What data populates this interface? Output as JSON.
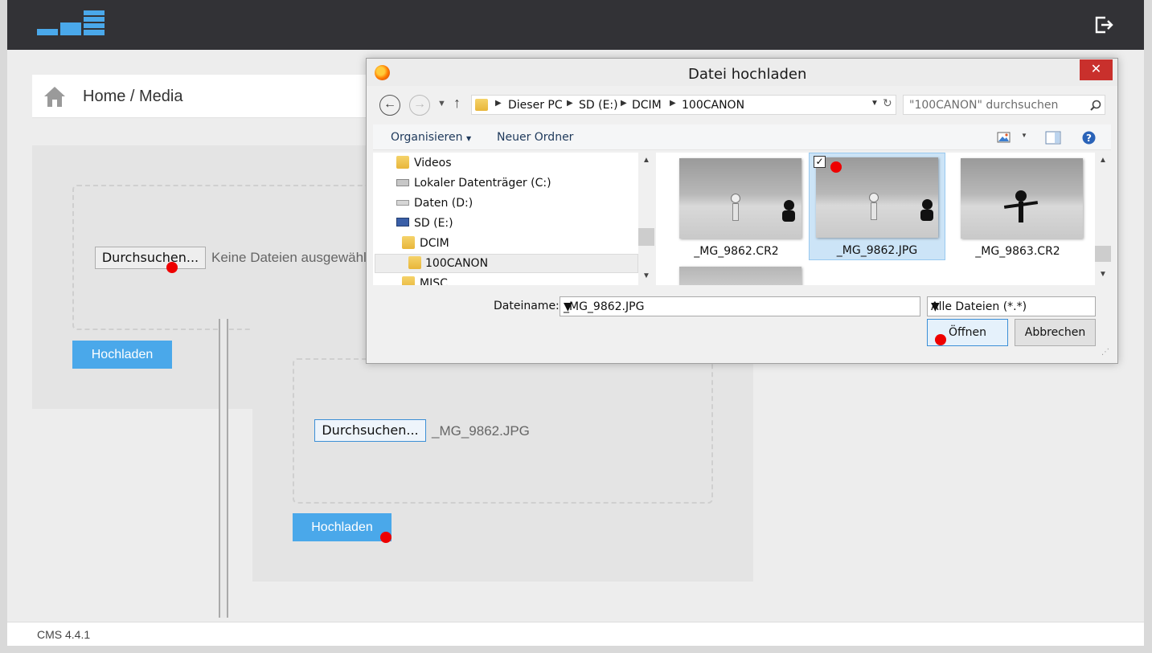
{
  "app": {
    "breadcrumb": "Home / Media",
    "version": "CMS 4.4.1",
    "colors": {
      "accent": "#4aa8ea",
      "topbar": "#323236",
      "close": "#c9302c",
      "marker": "#ee0000"
    }
  },
  "upload_before": {
    "browse_label": "Durchsuchen...",
    "file_status": "Keine Dateien ausgewählt",
    "upload_label": "Hochladen"
  },
  "upload_after": {
    "browse_label": "Durchsuchen...",
    "file_status": "_MG_9862.JPG",
    "upload_label": "Hochladen"
  },
  "dialog": {
    "title": "Datei hochladen",
    "close_glyph": "✕",
    "path": [
      "Dieser PC",
      "SD (E:)",
      "DCIM",
      "100CANON"
    ],
    "search_placeholder": "\"100CANON\" durchsuchen",
    "toolbar": {
      "organize": "Organisieren",
      "new_folder": "Neuer Ordner"
    },
    "tree": [
      {
        "label": "Videos",
        "icon": "videos-folder-icon"
      },
      {
        "label": "Lokaler Datenträger (C:)",
        "icon": "system-drive-icon"
      },
      {
        "label": "Daten (D:)",
        "icon": "drive-icon"
      },
      {
        "label": "SD (E:)",
        "icon": "sd-drive-icon"
      },
      {
        "label": "DCIM",
        "icon": "folder-icon"
      },
      {
        "label": "100CANON",
        "icon": "folder-icon",
        "selected": true
      },
      {
        "label": "MISC",
        "icon": "folder-icon"
      }
    ],
    "files": [
      {
        "name": "_MG_9862.CR2",
        "selected": false
      },
      {
        "name": "_MG_9862.JPG",
        "selected": true,
        "checked": true
      },
      {
        "name": "_MG_9863.CR2",
        "selected": false
      }
    ],
    "filename_label": "Dateiname:",
    "filename_value": "_MG_9862.JPG",
    "filter_value": "Alle Dateien (*.*)",
    "open_label": "Öffnen",
    "cancel_label": "Abbrechen"
  }
}
